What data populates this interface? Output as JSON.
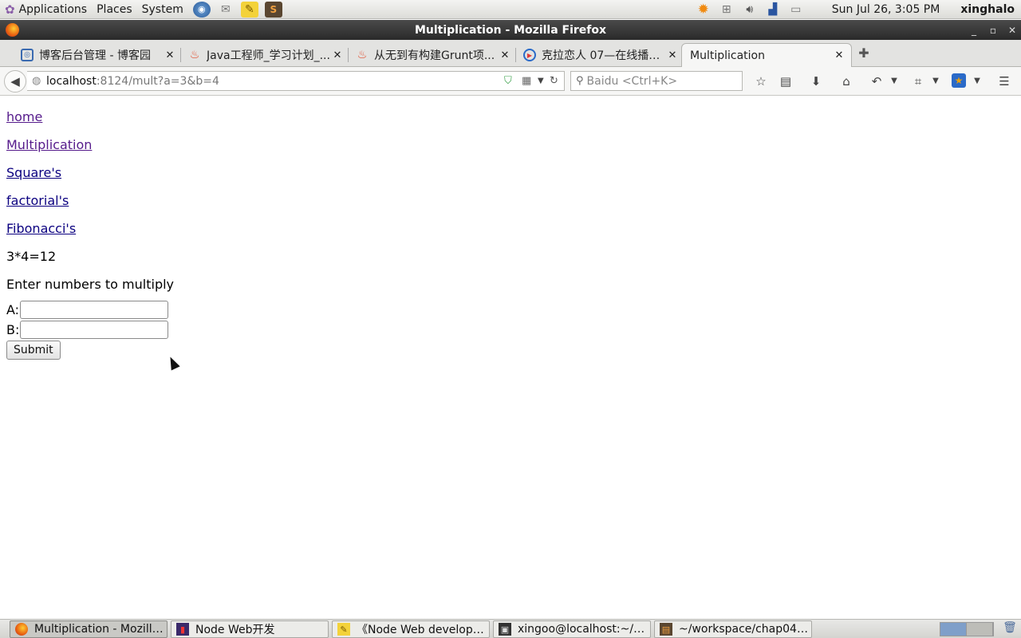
{
  "top_panel": {
    "menus": [
      "Applications",
      "Places",
      "System"
    ],
    "launchers": [
      "globe-icon",
      "mail-icon",
      "notes-icon",
      "editor-icon"
    ],
    "tray": [
      "weather-icon",
      "network-icon",
      "volume-icon",
      "signal-icon",
      "battery-icon"
    ],
    "clock": "Sun Jul 26,  3:05 PM",
    "username": "xinghalo"
  },
  "window": {
    "title": "Multiplication - Mozilla Firefox"
  },
  "tabs": [
    {
      "label": "博客后台管理 - 博客园",
      "icon": "cnblogs-icon"
    },
    {
      "label": "Java工程师_学习计划_...",
      "icon": "flame-icon"
    },
    {
      "label": "从无到有构建Grunt项...",
      "icon": "flame-icon"
    },
    {
      "label": "克拉恋人 07—在线播放...",
      "icon": "play-icon"
    },
    {
      "label": "Multiplication",
      "icon": ""
    }
  ],
  "navbar": {
    "url_host": "localhost",
    "url_rest": ":8124/mult?a=3&b=4",
    "search_placeholder": "Baidu <Ctrl+K>"
  },
  "page": {
    "links": [
      {
        "label": "home",
        "visited": true
      },
      {
        "label": "Multiplication",
        "visited": true
      },
      {
        "label": "Square's",
        "visited": false
      },
      {
        "label": "factorial's",
        "visited": false
      },
      {
        "label": "Fibonacci's",
        "visited": false
      }
    ],
    "result": "3*4=12",
    "prompt": "Enter numbers to multiply",
    "field_a_label": "A:",
    "field_b_label": "B:",
    "field_a_value": "",
    "field_b_value": "",
    "submit_label": "Submit"
  },
  "taskbar": {
    "tasks": [
      {
        "label": "Multiplication - Mozilla...",
        "active": true
      },
      {
        "label": "Node Web开发",
        "active": false
      },
      {
        "label": "《Node Web developer...",
        "active": false
      },
      {
        "label": "xingoo@localhost:~/w...",
        "active": false
      },
      {
        "label": "~/workspace/chap04/...",
        "active": false
      }
    ]
  },
  "colors": {
    "visited_link": "#551a8b",
    "link": "#0b0080",
    "titlebar": "#2a2a2a"
  }
}
